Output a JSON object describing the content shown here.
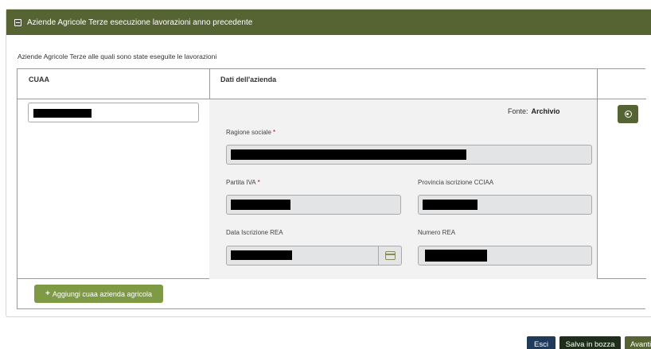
{
  "panel": {
    "title": "Aziende Agricole Terze esecuzione lavorazioni anno precedente",
    "section_label": "Aziende Agricole Terze alle quali sono state eseguite le lavorazioni"
  },
  "table": {
    "col_cuaa": "CUAA",
    "col_dati": "Dati dell'azienda"
  },
  "row": {
    "source_label": "Fonte:",
    "source_value": "Archivio",
    "ragione_sociale_label": "Ragione sociale",
    "partita_iva_label": "Partita IVA",
    "provincia_label": "Provincia iscrizione CCIAA",
    "data_rea_label": "Data Iscrizione REA",
    "numero_rea_label": "Numero REA",
    "required_mark": "*"
  },
  "actions": {
    "add_label": "Aggiungi cuaa azienda agricola",
    "esci": "Esci",
    "salva": "Salva in bozza",
    "avanti": "Avanti"
  },
  "colors": {
    "header_bg": "#566434",
    "add_button": "#7f9a44",
    "esci_button": "#203a5a",
    "salva_button": "#1f2e1b"
  }
}
